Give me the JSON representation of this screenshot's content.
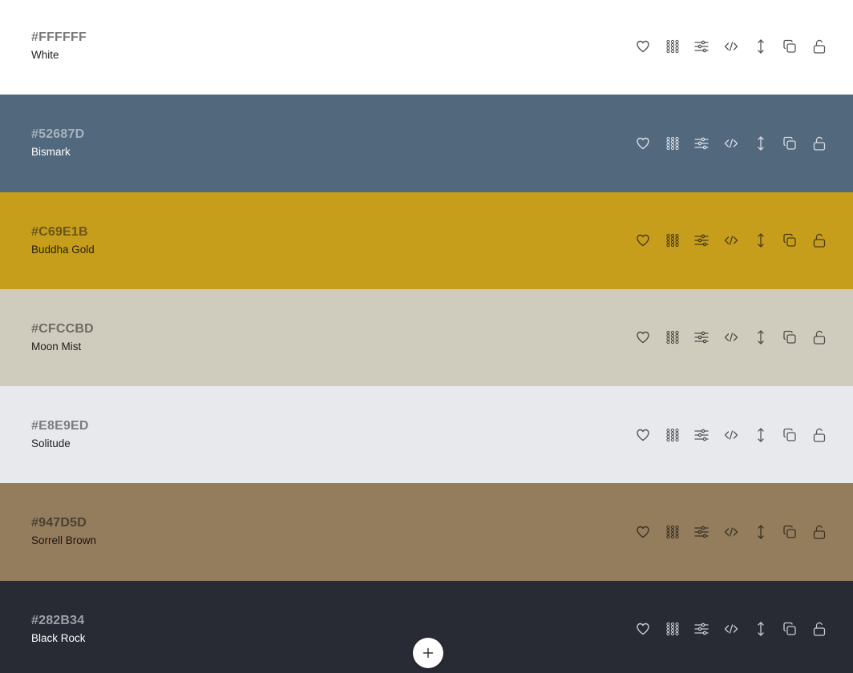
{
  "palette": {
    "colors": [
      {
        "hex": "#FFFFFF",
        "name": "White",
        "background": "#FFFFFF",
        "hex_text_color": "#7a7a7a",
        "name_text_color": "#222222",
        "icon_color": "#555555"
      },
      {
        "hex": "#52687D",
        "name": "Bismark",
        "background": "#52687D",
        "hex_text_color": "#a6b3bf",
        "name_text_color": "#ffffff",
        "icon_color": "#d8dee4"
      },
      {
        "hex": "#C69E1B",
        "name": "Buddha Gold",
        "background": "#C69E1B",
        "hex_text_color": "#6b5612",
        "name_text_color": "#2a2208",
        "icon_color": "#4a3c10"
      },
      {
        "hex": "#CFCCBD",
        "name": "Moon Mist",
        "background": "#CFCCBD",
        "hex_text_color": "#6e6c64",
        "name_text_color": "#1e1e1c",
        "icon_color": "#4e4d48"
      },
      {
        "hex": "#E8E9ED",
        "name": "Solitude",
        "background": "#E8E9ED",
        "hex_text_color": "#7c7d80",
        "name_text_color": "#202124",
        "icon_color": "#55565a"
      },
      {
        "hex": "#947D5D",
        "name": "Sorrell Brown",
        "background": "#947D5D",
        "hex_text_color": "#4d4132",
        "name_text_color": "#1b160f",
        "icon_color": "#3a3124"
      },
      {
        "hex": "#282B34",
        "name": "Black Rock",
        "background": "#282B34",
        "hex_text_color": "#9da0a8",
        "name_text_color": "#ffffff",
        "icon_color": "#c9cbd1"
      }
    ],
    "actions": [
      "heart-icon",
      "palette-grid-icon",
      "adjust-sliders-icon",
      "code-icon",
      "drag-vertical-icon",
      "copy-icon",
      "lock-open-icon"
    ]
  },
  "add_button": {
    "icon": "plus-icon"
  }
}
